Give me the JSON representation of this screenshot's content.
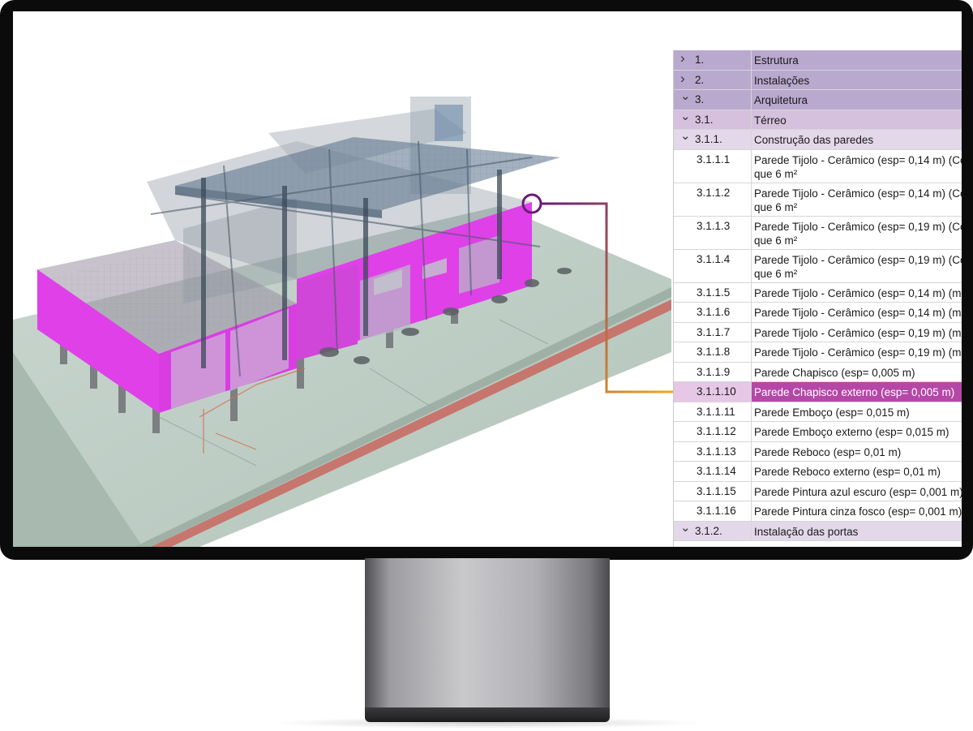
{
  "tree": {
    "rows": [
      {
        "num": "1.",
        "label": "Estrutura",
        "level": "g1",
        "chevron": "collapsed"
      },
      {
        "num": "2.",
        "label": "Instalações",
        "level": "g1",
        "chevron": "collapsed"
      },
      {
        "num": "3.",
        "label": "Arquitetura",
        "level": "g1",
        "chevron": "expanded"
      },
      {
        "num": "3.1.",
        "label": "Térreo",
        "level": "g2",
        "chevron": "expanded"
      },
      {
        "num": "3.1.1.",
        "label": "Construção das paredes",
        "level": "g3",
        "chevron": "expanded"
      },
      {
        "num": "3.1.1.1",
        "label": "Parede Tijolo - Cerâmico (esp= 0,14 m) (Co",
        "label2": "que 6 m²"
      },
      {
        "num": "3.1.1.2",
        "label": "Parede Tijolo - Cerâmico (esp= 0,14 m) (Co",
        "label2": "que 6 m²"
      },
      {
        "num": "3.1.1.3",
        "label": "Parede Tijolo - Cerâmico (esp= 0,19 m) (Co",
        "label2": "que 6 m²"
      },
      {
        "num": "3.1.1.4",
        "label": "Parede Tijolo - Cerâmico (esp= 0,19 m) (Co",
        "label2": "que 6 m²"
      },
      {
        "num": "3.1.1.5",
        "label": "Parede Tijolo - Cerâmico (esp= 0,14 m) (m"
      },
      {
        "num": "3.1.1.6",
        "label": "Parede Tijolo - Cerâmico (esp= 0,14 m) (m"
      },
      {
        "num": "3.1.1.7",
        "label": "Parede Tijolo - Cerâmico (esp= 0,19 m) (m"
      },
      {
        "num": "3.1.1.8",
        "label": "Parede Tijolo - Cerâmico (esp= 0,19 m) (m"
      },
      {
        "num": "3.1.1.9",
        "label": "Parede Chapisco (esp= 0,005 m)"
      },
      {
        "num": "3.1.1.10",
        "label": "Parede Chapisco externo (esp= 0,005 m)",
        "selected": true
      },
      {
        "num": "3.1.1.11",
        "label": "Parede Emboço (esp= 0,015 m)"
      },
      {
        "num": "3.1.1.12",
        "label": "Parede Emboço externo (esp= 0,015 m)"
      },
      {
        "num": "3.1.1.13",
        "label": "Parede Reboco (esp= 0,01 m)"
      },
      {
        "num": "3.1.1.14",
        "label": "Parede Reboco externo (esp= 0,01 m)"
      },
      {
        "num": "3.1.1.15",
        "label": "Parede Pintura azul escuro (esp= 0,001 m)"
      },
      {
        "num": "3.1.1.16",
        "label": "Parede Pintura cinza fosco (esp= 0,001 m)"
      },
      {
        "num": "3.1.2.",
        "label": "Instalação das portas",
        "level": "g3",
        "chevron": "expanded"
      }
    ]
  },
  "colors": {
    "highlight_wall": "#e040e8",
    "selection": "#b548a6",
    "callout_gradient_start": "#6a1b7a",
    "callout_gradient_end": "#f2a81d"
  },
  "icons": {
    "collapsed": "chevron-right-icon",
    "expanded": "chevron-down-icon"
  }
}
